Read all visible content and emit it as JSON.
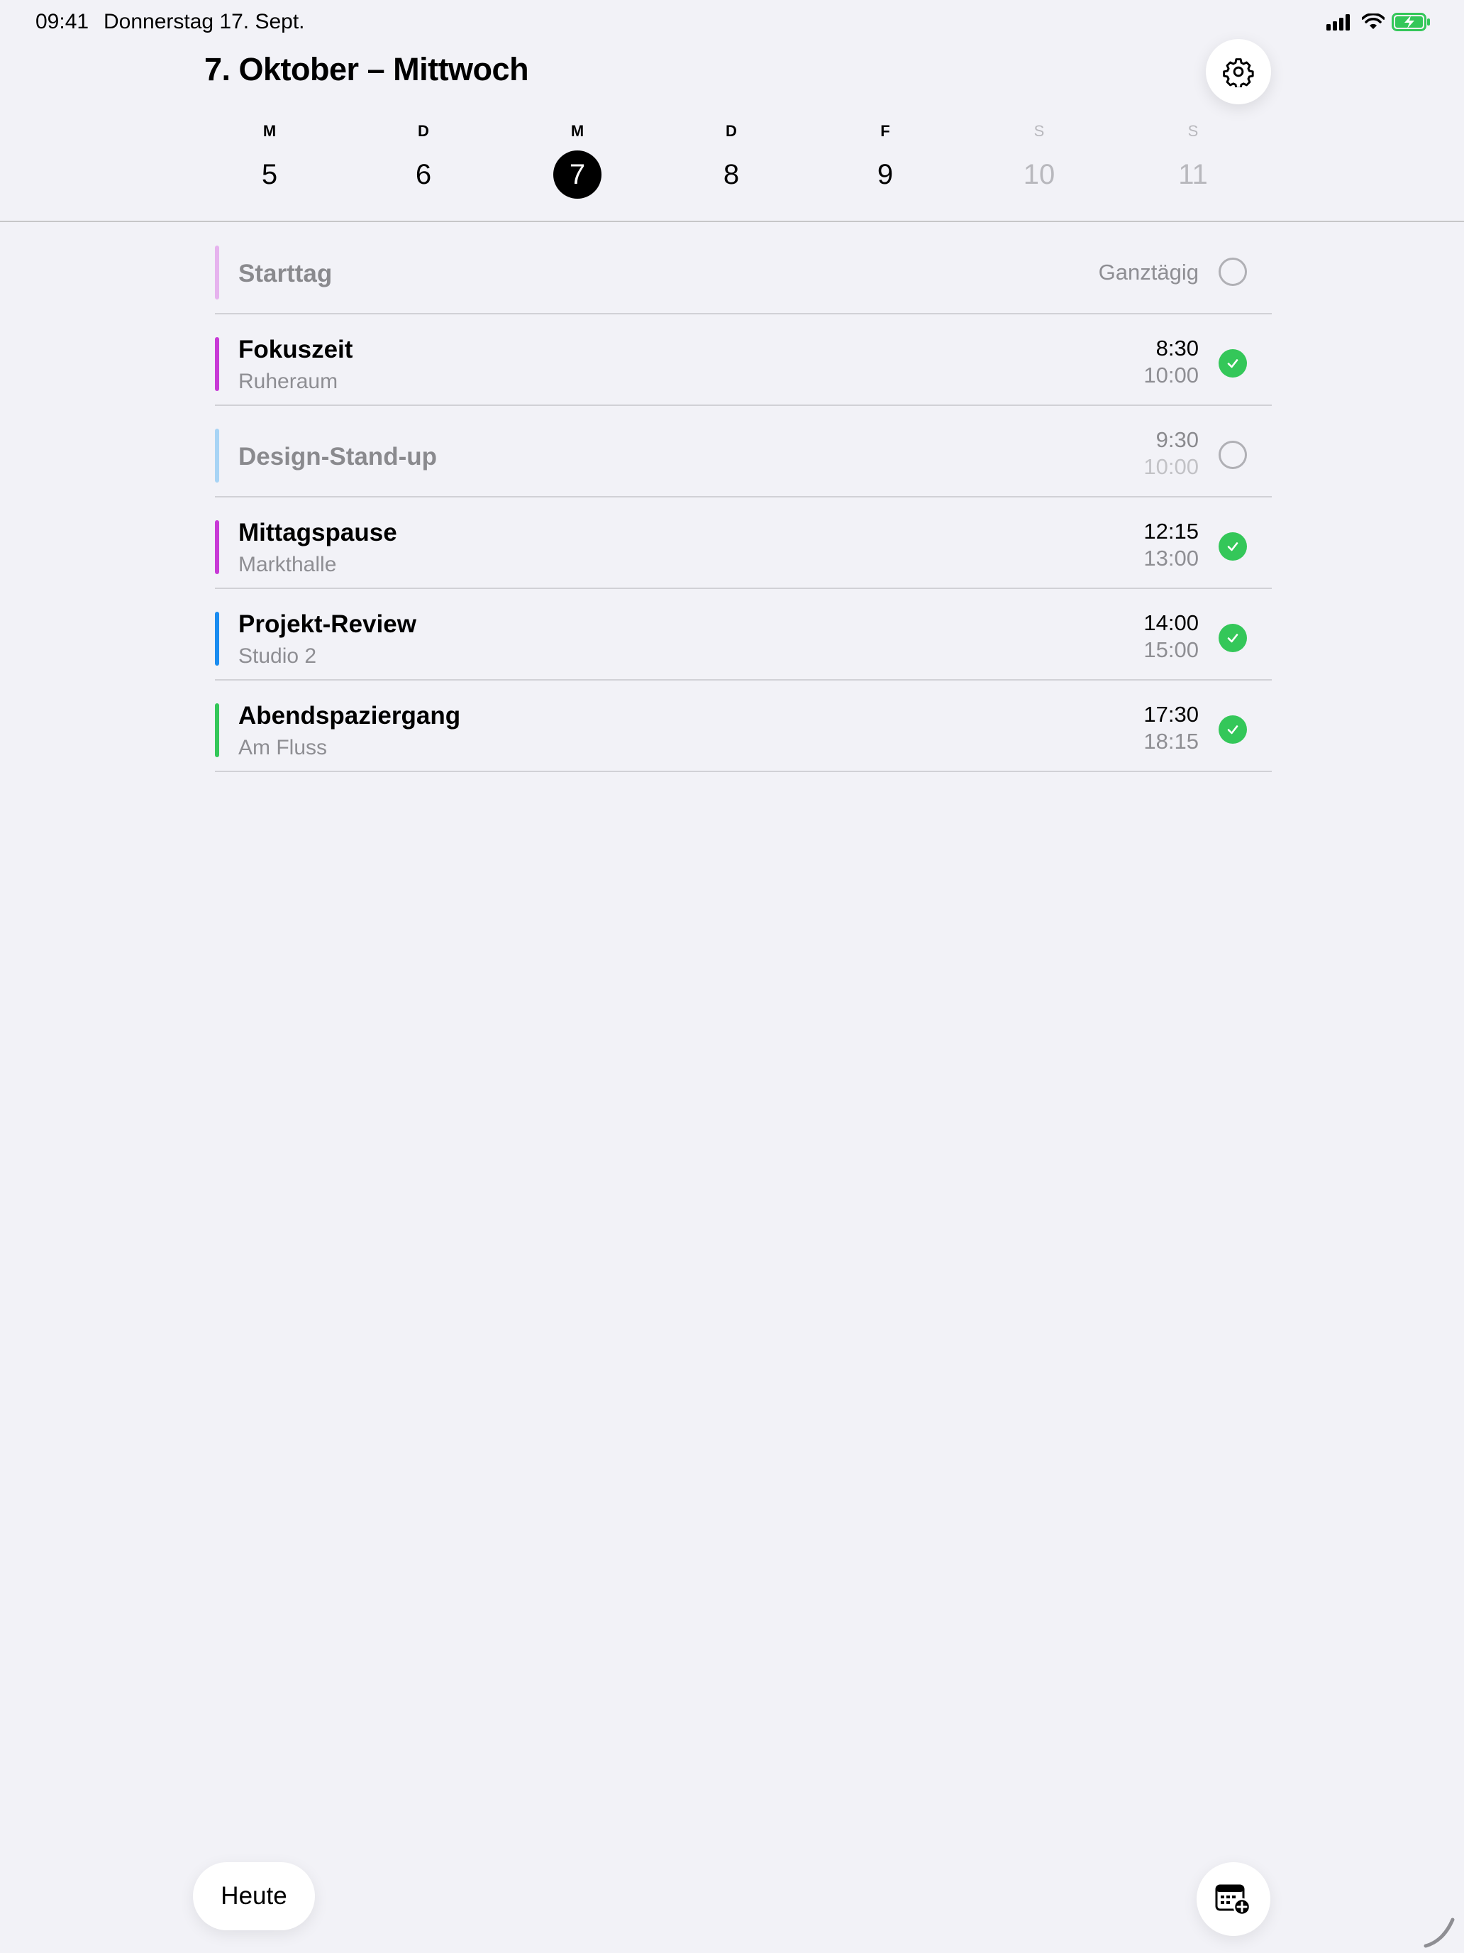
{
  "status_bar": {
    "time": "09:41",
    "date": "Donnerstag 17. Sept.",
    "icons": [
      "cellular-signal-icon",
      "wifi-icon",
      "battery-charging-icon"
    ]
  },
  "header": {
    "title": "7. Oktober – Mittwoch",
    "settings_icon": "gear-icon"
  },
  "week": [
    {
      "weekday": "M",
      "day": "5",
      "state": "normal"
    },
    {
      "weekday": "D",
      "day": "6",
      "state": "normal"
    },
    {
      "weekday": "M",
      "day": "7",
      "state": "selected"
    },
    {
      "weekday": "D",
      "day": "8",
      "state": "normal"
    },
    {
      "weekday": "F",
      "day": "9",
      "state": "normal"
    },
    {
      "weekday": "S",
      "day": "10",
      "state": "weekend"
    },
    {
      "weekday": "S",
      "day": "11",
      "state": "weekend"
    }
  ],
  "events": [
    {
      "title": "Starttag",
      "subtitle": "",
      "all_day_label": "Ganztägig",
      "start": "",
      "end": "",
      "color": "#e6b3ee",
      "done": false,
      "muted": true
    },
    {
      "title": "Fokuszeit",
      "subtitle": "Ruheraum",
      "all_day_label": "",
      "start": "8:30",
      "end": "10:00",
      "color": "#c83ad6",
      "done": true,
      "muted": false
    },
    {
      "title": "Design-Stand-up",
      "subtitle": "",
      "all_day_label": "",
      "start": "9:30",
      "end": "10:00",
      "color": "#a8d4f5",
      "done": false,
      "muted": true
    },
    {
      "title": "Mittagspause",
      "subtitle": "Markthalle",
      "all_day_label": "",
      "start": "12:15",
      "end": "13:00",
      "color": "#c83ad6",
      "done": true,
      "muted": false
    },
    {
      "title": "Projekt-Review",
      "subtitle": "Studio 2",
      "all_day_label": "",
      "start": "14:00",
      "end": "15:00",
      "color": "#1a8cf0",
      "done": true,
      "muted": false
    },
    {
      "title": "Abendspaziergang",
      "subtitle": "Am Fluss",
      "all_day_label": "",
      "start": "17:30",
      "end": "18:15",
      "color": "#34c759",
      "done": true,
      "muted": false
    }
  ],
  "footer": {
    "today_label": "Heute",
    "add_event_icon": "calendar-add-icon"
  },
  "colors": {
    "background": "#f2f2f7",
    "done_green": "#34c759",
    "selected_day": "#000000"
  }
}
